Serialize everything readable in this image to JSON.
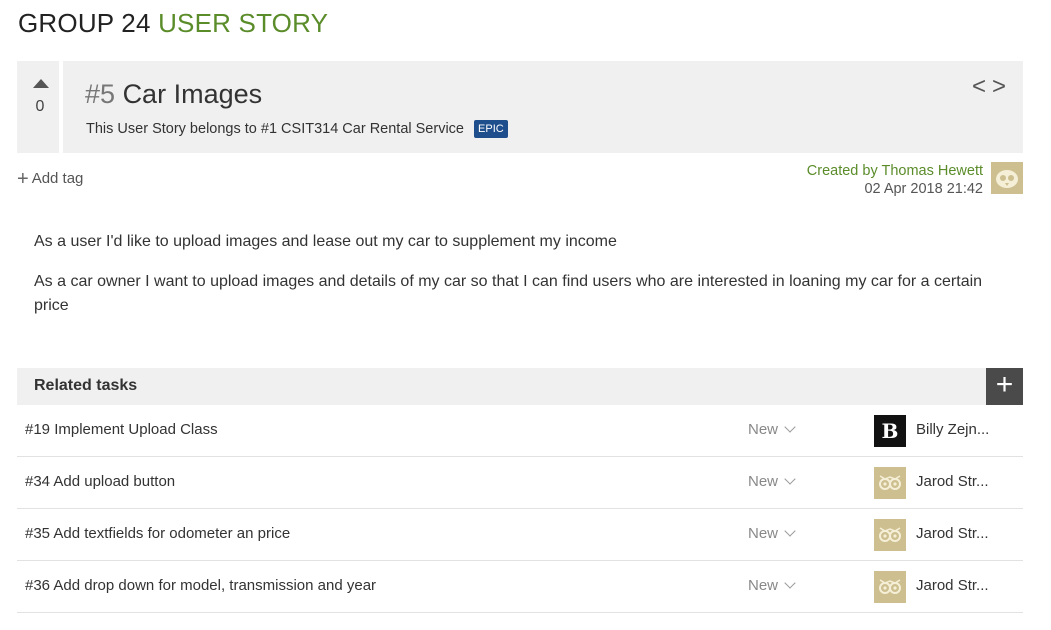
{
  "project": {
    "name": "GROUP 24",
    "section": "USER STORY"
  },
  "story": {
    "votes": "0",
    "ref": "#5",
    "title": "Car Images",
    "belongs_prefix": "This User Story belongs to",
    "epic_link": "#1 CSIT314 Car Rental Service",
    "epic_badge": "EPIC",
    "nav_prev": "<",
    "nav_next": ">"
  },
  "tags": {
    "add_label": "Add tag"
  },
  "creator": {
    "created_by": "Created by Thomas Hewett",
    "date": "02 Apr 2018 21:42"
  },
  "description": {
    "lines": [
      "As a user I'd like to upload images and lease out my car to supplement my income",
      "As a car owner I want to upload images and details of my car so that I can find users who are interested in loaning my car for a certain price"
    ]
  },
  "related_tasks": {
    "title": "Related tasks",
    "add_label": "+",
    "tasks": [
      {
        "name": "#19 Implement Upload Class",
        "status": "New",
        "assignee": "Billy Zejn...",
        "avatar": "B"
      },
      {
        "name": "#34 Add upload button",
        "status": "New",
        "assignee": "Jarod Str...",
        "avatar": "owl"
      },
      {
        "name": "#35 Add textfields for odometer an price",
        "status": "New",
        "assignee": "Jarod Str...",
        "avatar": "owl"
      },
      {
        "name": "#36 Add drop down for model, transmission and year",
        "status": "New",
        "assignee": "Jarod Str...",
        "avatar": "owl"
      }
    ]
  },
  "colors": {
    "accent": "#5b8c2a",
    "epic_badge": "#1f4e8c",
    "panel_bg": "#f0f0f0"
  }
}
